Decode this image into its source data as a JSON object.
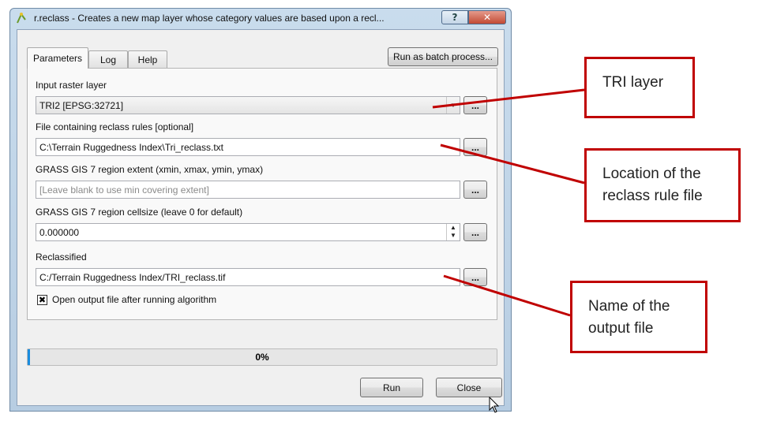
{
  "window": {
    "title": "r.reclass - Creates a new map layer whose category values are based upon a recl...",
    "help_glyph": "?",
    "close_glyph": "✕"
  },
  "tabs": [
    {
      "label": "Parameters",
      "active": true
    },
    {
      "label": "Log",
      "active": false
    },
    {
      "label": "Help",
      "active": false
    }
  ],
  "batch_button": "Run as batch process...",
  "params": {
    "input_label": "Input raster layer",
    "input_value": "TRI2 [EPSG:32721]",
    "rules_label": "File containing reclass rules [optional]",
    "rules_value": "C:\\Terrain Ruggedness Index\\Tri_reclass.txt",
    "region_label": "GRASS GIS 7 region extent (xmin, xmax, ymin, ymax)",
    "region_placeholder": "[Leave blank to use min covering extent]",
    "cellsize_label": "GRASS GIS 7 region cellsize (leave 0 for default)",
    "cellsize_value": "0.000000",
    "output_label": "Reclassified",
    "output_value": "C:/Terrain Ruggedness Index/TRI_reclass.tif",
    "open_output_label": "Open output file after running algorithm",
    "open_output_checked": true,
    "browse_label": "..."
  },
  "progress": {
    "value": 0.0,
    "text": "0%",
    "color": "#1a8cde"
  },
  "buttons": {
    "run": "Run",
    "close": "Close"
  },
  "annotations": {
    "tri_layer": "TRI layer",
    "rule_file_line1": "Location of the",
    "rule_file_line2": "reclass rule file",
    "output_line1": "Name of the",
    "output_line2": "output file",
    "color": "#c00000"
  }
}
